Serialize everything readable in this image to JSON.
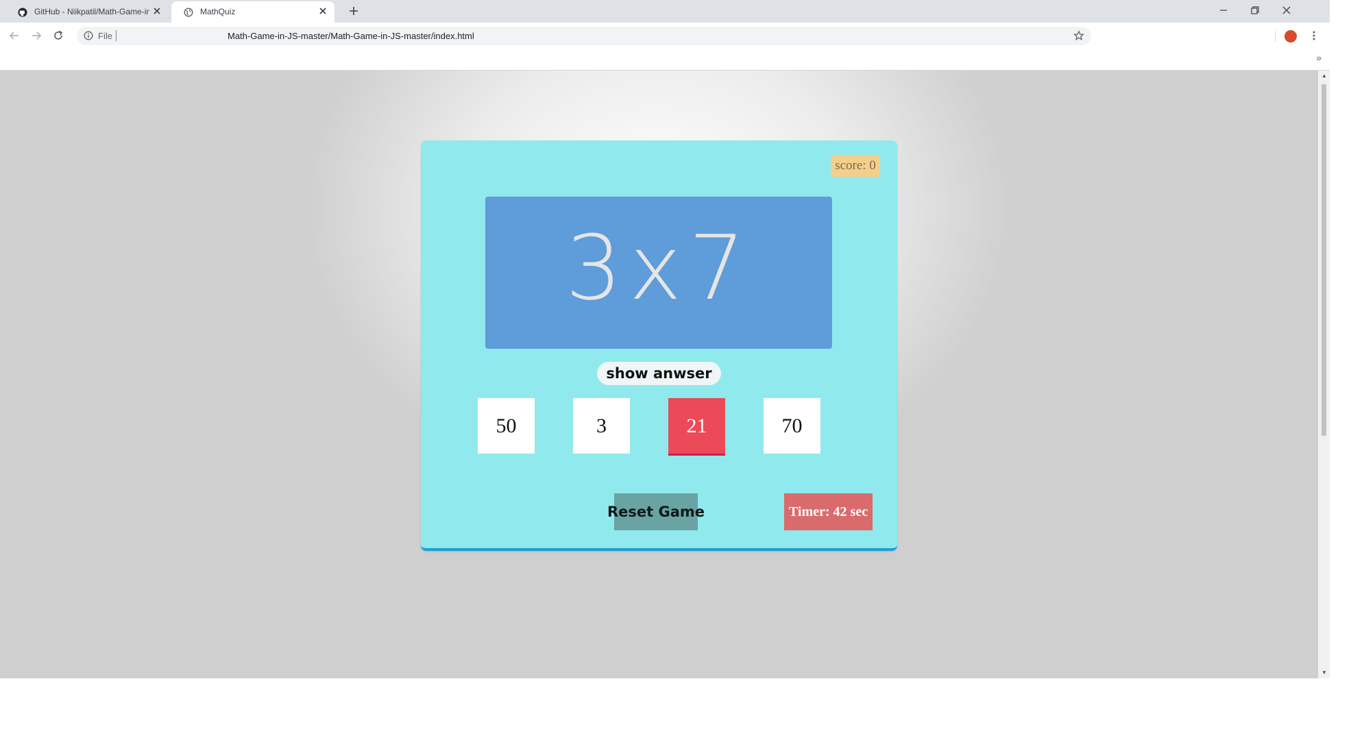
{
  "browser": {
    "tabs": [
      {
        "title": "GitHub - Niikpatil/Math-Game-in",
        "icon": "github-icon",
        "active": false
      },
      {
        "title": "MathQuiz",
        "icon": "globe-icon",
        "active": true
      }
    ],
    "omnibox": {
      "scheme_label": "File",
      "url": "Math-Game-in-JS-master/Math-Game-in-JS-master/index.html"
    },
    "bookmarks_overflow": "»"
  },
  "game": {
    "score_label": "score: 0",
    "question": "3x7",
    "show_answer_label": "show anwser",
    "choices": [
      "50",
      "3",
      "21",
      "70"
    ],
    "selected_choice_index": 2,
    "reset_label": "Reset Game",
    "timer_label": "Timer: 42 sec"
  },
  "colors": {
    "container_bg": "#90e9ed",
    "question_bg": "#5e9cda",
    "selected_choice": "#ec4a59",
    "reset_bg": "#6aa3a3",
    "timer_bg": "#d96b6d",
    "score_bg": "#f4cf8b"
  }
}
